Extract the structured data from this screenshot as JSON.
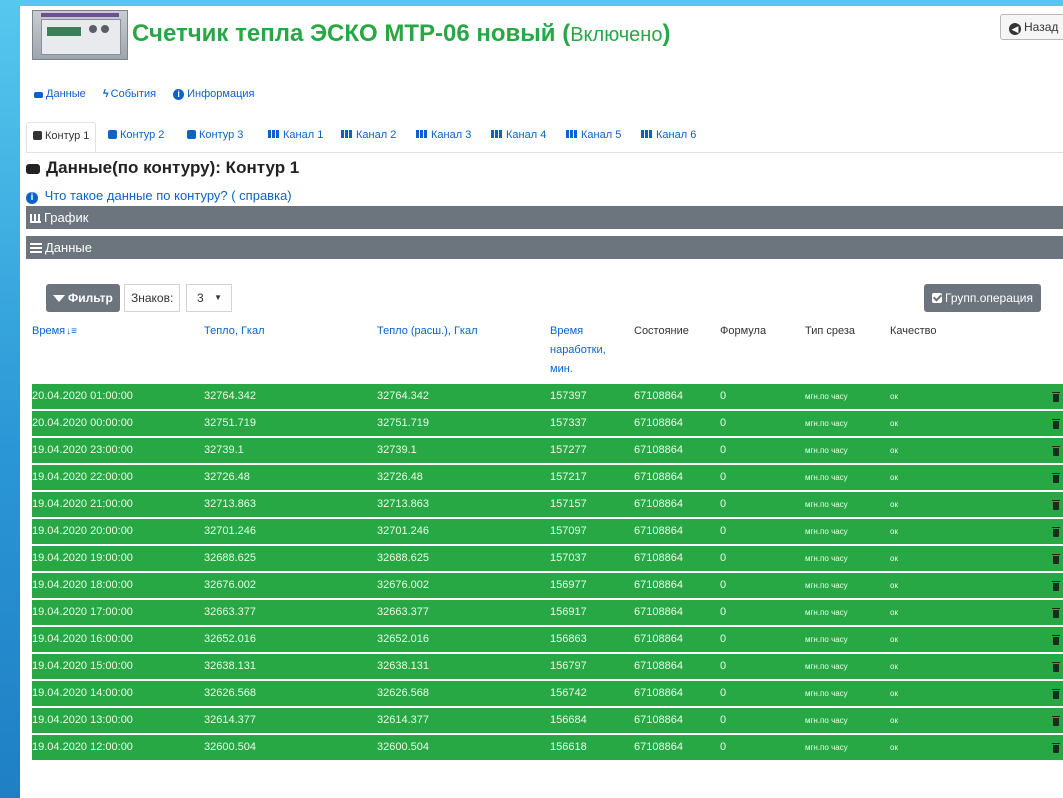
{
  "header": {
    "title": "Счетчик тепла ЭСКО МТР-06 новый",
    "paren_open": "(",
    "state": "Включено",
    "paren_close": ")",
    "back_label": "Назад"
  },
  "nav": {
    "items": [
      {
        "label": "Данные",
        "icon": "database-icon"
      },
      {
        "label": "События",
        "icon": "bolt-icon"
      },
      {
        "label": "Информация",
        "icon": "info-icon"
      }
    ]
  },
  "tabs": [
    {
      "label": "Контур 1",
      "active": true
    },
    {
      "label": "Контур 2"
    },
    {
      "label": "Контур 3"
    },
    {
      "label": "Канал 1"
    },
    {
      "label": "Канал 2"
    },
    {
      "label": "Канал 3"
    },
    {
      "label": "Канал 4"
    },
    {
      "label": "Канал 5"
    },
    {
      "label": "Канал 6"
    }
  ],
  "page": {
    "heading": "Данные(по контуру): Контур 1",
    "help_link": "Что такое данные по контуру? ( справка)"
  },
  "sections": {
    "chart_label": "График",
    "data_label": "Данные"
  },
  "toolbar": {
    "filter_label": "Фильтр",
    "digits_label": "Знаков:",
    "digits_value": "3",
    "group_label": "Групп.операция"
  },
  "table": {
    "columns": {
      "time": "Время",
      "heat": "Тепло, Гкал",
      "heat_calc": "Тепло (расш.), Гкал",
      "runtime_1": "Время",
      "runtime_2": "наработки,",
      "runtime_3": "мин.",
      "state": "Состояние",
      "formula": "Формула",
      "cut": "Тип среза",
      "quality": "Качество"
    },
    "rows": [
      {
        "time": "20.04.2020 01:00:00",
        "heat": "32764.342",
        "heat_calc": "32764.342",
        "runtime": "157397",
        "state": "67108864",
        "formula": "0",
        "cut": "мгн.по часу",
        "quality": "ок"
      },
      {
        "time": "20.04.2020 00:00:00",
        "heat": "32751.719",
        "heat_calc": "32751.719",
        "runtime": "157337",
        "state": "67108864",
        "formula": "0",
        "cut": "мгн.по часу",
        "quality": "ок"
      },
      {
        "time": "19.04.2020 23:00:00",
        "heat": "32739.1",
        "heat_calc": "32739.1",
        "runtime": "157277",
        "state": "67108864",
        "formula": "0",
        "cut": "мгн.по часу",
        "quality": "ок"
      },
      {
        "time": "19.04.2020 22:00:00",
        "heat": "32726.48",
        "heat_calc": "32726.48",
        "runtime": "157217",
        "state": "67108864",
        "formula": "0",
        "cut": "мгн.по часу",
        "quality": "ок"
      },
      {
        "time": "19.04.2020 21:00:00",
        "heat": "32713.863",
        "heat_calc": "32713.863",
        "runtime": "157157",
        "state": "67108864",
        "formula": "0",
        "cut": "мгн.по часу",
        "quality": "ок"
      },
      {
        "time": "19.04.2020 20:00:00",
        "heat": "32701.246",
        "heat_calc": "32701.246",
        "runtime": "157097",
        "state": "67108864",
        "formula": "0",
        "cut": "мгн.по часу",
        "quality": "ок"
      },
      {
        "time": "19.04.2020 19:00:00",
        "heat": "32688.625",
        "heat_calc": "32688.625",
        "runtime": "157037",
        "state": "67108864",
        "formula": "0",
        "cut": "мгн.по часу",
        "quality": "ок"
      },
      {
        "time": "19.04.2020 18:00:00",
        "heat": "32676.002",
        "heat_calc": "32676.002",
        "runtime": "156977",
        "state": "67108864",
        "formula": "0",
        "cut": "мгн.по часу",
        "quality": "ок"
      },
      {
        "time": "19.04.2020 17:00:00",
        "heat": "32663.377",
        "heat_calc": "32663.377",
        "runtime": "156917",
        "state": "67108864",
        "formula": "0",
        "cut": "мгн.по часу",
        "quality": "ок"
      },
      {
        "time": "19.04.2020 16:00:00",
        "heat": "32652.016",
        "heat_calc": "32652.016",
        "runtime": "156863",
        "state": "67108864",
        "formula": "0",
        "cut": "мгн.по часу",
        "quality": "ок"
      },
      {
        "time": "19.04.2020 15:00:00",
        "heat": "32638.131",
        "heat_calc": "32638.131",
        "runtime": "156797",
        "state": "67108864",
        "formula": "0",
        "cut": "мгн.по часу",
        "quality": "ок"
      },
      {
        "time": "19.04.2020 14:00:00",
        "heat": "32626.568",
        "heat_calc": "32626.568",
        "runtime": "156742",
        "state": "67108864",
        "formula": "0",
        "cut": "мгн.по часу",
        "quality": "ок"
      },
      {
        "time": "19.04.2020 13:00:00",
        "heat": "32614.377",
        "heat_calc": "32614.377",
        "runtime": "156684",
        "state": "67108864",
        "formula": "0",
        "cut": "мгн.по часу",
        "quality": "ок"
      },
      {
        "time": "19.04.2020 12:00:00",
        "heat": "32600.504",
        "heat_calc": "32600.504",
        "runtime": "156618",
        "state": "67108864",
        "formula": "0",
        "cut": "мгн.по часу",
        "quality": "ок"
      }
    ]
  },
  "colors": {
    "row_green": "#28a745",
    "title_green": "#28a745",
    "link_blue": "#0b63c9",
    "bar_gray": "#6c757d"
  }
}
